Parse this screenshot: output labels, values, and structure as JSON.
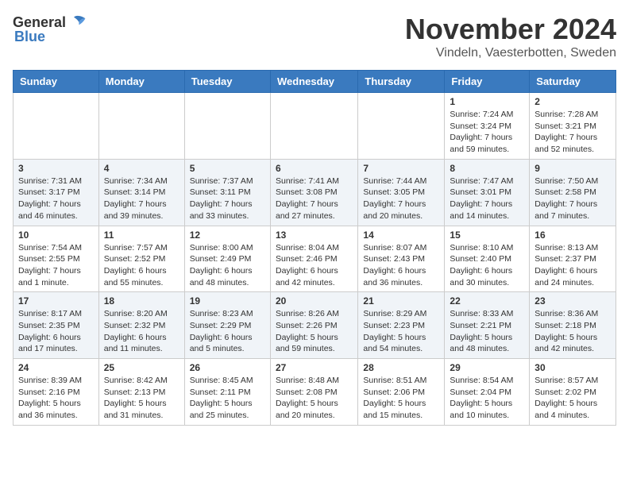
{
  "header": {
    "logo_general": "General",
    "logo_blue": "Blue",
    "month_title": "November 2024",
    "location": "Vindeln, Vaesterbotten, Sweden"
  },
  "weekdays": [
    "Sunday",
    "Monday",
    "Tuesday",
    "Wednesday",
    "Thursday",
    "Friday",
    "Saturday"
  ],
  "weeks": [
    [
      {
        "day": "",
        "info": ""
      },
      {
        "day": "",
        "info": ""
      },
      {
        "day": "",
        "info": ""
      },
      {
        "day": "",
        "info": ""
      },
      {
        "day": "",
        "info": ""
      },
      {
        "day": "1",
        "info": "Sunrise: 7:24 AM\nSunset: 3:24 PM\nDaylight: 7 hours and 59 minutes."
      },
      {
        "day": "2",
        "info": "Sunrise: 7:28 AM\nSunset: 3:21 PM\nDaylight: 7 hours and 52 minutes."
      }
    ],
    [
      {
        "day": "3",
        "info": "Sunrise: 7:31 AM\nSunset: 3:17 PM\nDaylight: 7 hours and 46 minutes."
      },
      {
        "day": "4",
        "info": "Sunrise: 7:34 AM\nSunset: 3:14 PM\nDaylight: 7 hours and 39 minutes."
      },
      {
        "day": "5",
        "info": "Sunrise: 7:37 AM\nSunset: 3:11 PM\nDaylight: 7 hours and 33 minutes."
      },
      {
        "day": "6",
        "info": "Sunrise: 7:41 AM\nSunset: 3:08 PM\nDaylight: 7 hours and 27 minutes."
      },
      {
        "day": "7",
        "info": "Sunrise: 7:44 AM\nSunset: 3:05 PM\nDaylight: 7 hours and 20 minutes."
      },
      {
        "day": "8",
        "info": "Sunrise: 7:47 AM\nSunset: 3:01 PM\nDaylight: 7 hours and 14 minutes."
      },
      {
        "day": "9",
        "info": "Sunrise: 7:50 AM\nSunset: 2:58 PM\nDaylight: 7 hours and 7 minutes."
      }
    ],
    [
      {
        "day": "10",
        "info": "Sunrise: 7:54 AM\nSunset: 2:55 PM\nDaylight: 7 hours and 1 minute."
      },
      {
        "day": "11",
        "info": "Sunrise: 7:57 AM\nSunset: 2:52 PM\nDaylight: 6 hours and 55 minutes."
      },
      {
        "day": "12",
        "info": "Sunrise: 8:00 AM\nSunset: 2:49 PM\nDaylight: 6 hours and 48 minutes."
      },
      {
        "day": "13",
        "info": "Sunrise: 8:04 AM\nSunset: 2:46 PM\nDaylight: 6 hours and 42 minutes."
      },
      {
        "day": "14",
        "info": "Sunrise: 8:07 AM\nSunset: 2:43 PM\nDaylight: 6 hours and 36 minutes."
      },
      {
        "day": "15",
        "info": "Sunrise: 8:10 AM\nSunset: 2:40 PM\nDaylight: 6 hours and 30 minutes."
      },
      {
        "day": "16",
        "info": "Sunrise: 8:13 AM\nSunset: 2:37 PM\nDaylight: 6 hours and 24 minutes."
      }
    ],
    [
      {
        "day": "17",
        "info": "Sunrise: 8:17 AM\nSunset: 2:35 PM\nDaylight: 6 hours and 17 minutes."
      },
      {
        "day": "18",
        "info": "Sunrise: 8:20 AM\nSunset: 2:32 PM\nDaylight: 6 hours and 11 minutes."
      },
      {
        "day": "19",
        "info": "Sunrise: 8:23 AM\nSunset: 2:29 PM\nDaylight: 6 hours and 5 minutes."
      },
      {
        "day": "20",
        "info": "Sunrise: 8:26 AM\nSunset: 2:26 PM\nDaylight: 5 hours and 59 minutes."
      },
      {
        "day": "21",
        "info": "Sunrise: 8:29 AM\nSunset: 2:23 PM\nDaylight: 5 hours and 54 minutes."
      },
      {
        "day": "22",
        "info": "Sunrise: 8:33 AM\nSunset: 2:21 PM\nDaylight: 5 hours and 48 minutes."
      },
      {
        "day": "23",
        "info": "Sunrise: 8:36 AM\nSunset: 2:18 PM\nDaylight: 5 hours and 42 minutes."
      }
    ],
    [
      {
        "day": "24",
        "info": "Sunrise: 8:39 AM\nSunset: 2:16 PM\nDaylight: 5 hours and 36 minutes."
      },
      {
        "day": "25",
        "info": "Sunrise: 8:42 AM\nSunset: 2:13 PM\nDaylight: 5 hours and 31 minutes."
      },
      {
        "day": "26",
        "info": "Sunrise: 8:45 AM\nSunset: 2:11 PM\nDaylight: 5 hours and 25 minutes."
      },
      {
        "day": "27",
        "info": "Sunrise: 8:48 AM\nSunset: 2:08 PM\nDaylight: 5 hours and 20 minutes."
      },
      {
        "day": "28",
        "info": "Sunrise: 8:51 AM\nSunset: 2:06 PM\nDaylight: 5 hours and 15 minutes."
      },
      {
        "day": "29",
        "info": "Sunrise: 8:54 AM\nSunset: 2:04 PM\nDaylight: 5 hours and 10 minutes."
      },
      {
        "day": "30",
        "info": "Sunrise: 8:57 AM\nSunset: 2:02 PM\nDaylight: 5 hours and 4 minutes."
      }
    ]
  ]
}
